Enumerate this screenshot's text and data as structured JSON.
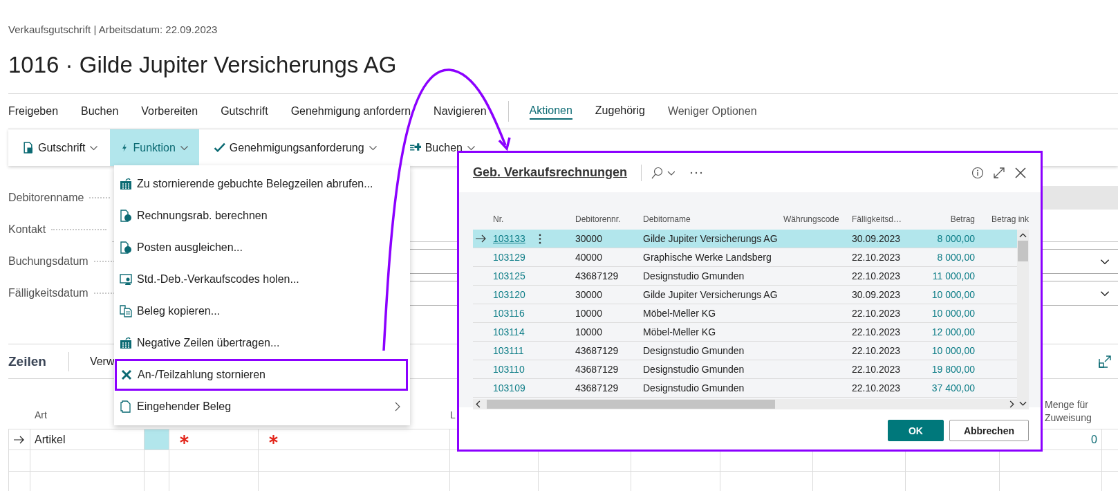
{
  "breadcrumb": "Verkaufsgutschrift | Arbeitsdatum: 22.09.2023",
  "title": "1016 · Gilde Jupiter Versicherungs AG",
  "action_groups": [
    "Freigeben",
    "Buchen",
    "Vorbereiten",
    "Gutschrift",
    "Genehmigung anfordern",
    "Navigieren"
  ],
  "tabs": [
    {
      "label": "Aktionen",
      "selected": true
    },
    {
      "label": "Zugehörig",
      "selected": false
    }
  ],
  "less_options": "Weniger Optionen",
  "toolbar": [
    {
      "label": "Gutschrift",
      "selected": false
    },
    {
      "label": "Funktion",
      "selected": true
    },
    {
      "label": "Genehmigungsanforderung",
      "selected": false
    },
    {
      "label": "Buchen",
      "selected": false
    }
  ],
  "menu": [
    {
      "label": "Zu stornierende gebuchte Belegzeilen abrufen...",
      "kind": "action",
      "annotated": false
    },
    {
      "label": "Rechnungsrab. berechnen",
      "kind": "action",
      "annotated": false
    },
    {
      "label": "Posten ausgleichen...",
      "kind": "action",
      "annotated": false
    },
    {
      "label": "Std.-Deb.-Verkaufscodes holen...",
      "kind": "action",
      "annotated": false
    },
    {
      "label": "Beleg kopieren...",
      "kind": "action",
      "annotated": false
    },
    {
      "label": "Negative Zeilen übertragen...",
      "kind": "action",
      "annotated": false
    },
    {
      "label": "An-/Teilzahlung stornieren",
      "kind": "action",
      "annotated": true
    },
    {
      "label": "Eingehender Beleg",
      "kind": "submenu",
      "annotated": false
    }
  ],
  "fields": [
    {
      "label": "Debitorenname",
      "kind": "readonly"
    },
    {
      "label": "Kontakt",
      "kind": "text"
    },
    {
      "label": "Buchungsdatum",
      "kind": "dropdown"
    },
    {
      "label": "Fälligkeitsdatum",
      "kind": "dropdown"
    }
  ],
  "lines": {
    "title": "Zeilen",
    "action": "Verw",
    "columns": [
      "Art",
      "L",
      "Menge für Zuweisung"
    ],
    "rows": [
      {
        "selected": true,
        "type": "Artikel",
        "required": true,
        "quantity": "0"
      }
    ]
  },
  "dialog": {
    "title": "Geb. Verkaufsrechnungen",
    "columns": [
      "Nr.",
      "Debitorennr.",
      "Debitorname",
      "Währungscode",
      "Fälligkeitsd…",
      "Betrag",
      "Betrag ink"
    ],
    "rows": [
      {
        "selected": true,
        "nr": "103133",
        "customer_no": "30000",
        "name": "Gilde Jupiter Versicherungs AG",
        "due": "30.09.2023",
        "amount": "8 000,00"
      },
      {
        "selected": false,
        "nr": "103129",
        "customer_no": "40000",
        "name": "Graphische Werke Landsberg",
        "due": "22.10.2023",
        "amount": "8 000,00"
      },
      {
        "selected": false,
        "nr": "103125",
        "customer_no": "43687129",
        "name": "Designstudio Gmunden",
        "due": "22.10.2023",
        "amount": "11 000,00"
      },
      {
        "selected": false,
        "nr": "103120",
        "customer_no": "30000",
        "name": "Gilde Jupiter Versicherungs AG",
        "due": "30.09.2023",
        "amount": "10 000,00"
      },
      {
        "selected": false,
        "nr": "103116",
        "customer_no": "10000",
        "name": "Möbel-Meller KG",
        "due": "22.10.2023",
        "amount": "10 000,00"
      },
      {
        "selected": false,
        "nr": "103114",
        "customer_no": "10000",
        "name": "Möbel-Meller KG",
        "due": "22.10.2023",
        "amount": "12 000,00"
      },
      {
        "selected": false,
        "nr": "103111",
        "customer_no": "43687129",
        "name": "Designstudio Gmunden",
        "due": "22.10.2023",
        "amount": "10 000,00"
      },
      {
        "selected": false,
        "nr": "103110",
        "customer_no": "43687129",
        "name": "Designstudio Gmunden",
        "due": "22.10.2023",
        "amount": "19 800,00"
      },
      {
        "selected": false,
        "nr": "103109",
        "customer_no": "43687129",
        "name": "Designstudio Gmunden",
        "due": "22.10.2023",
        "amount": "37 400,00"
      }
    ],
    "buttons": [
      {
        "label": "OK",
        "kind": "primary"
      },
      {
        "label": "Abbrechen",
        "kind": "secondary"
      }
    ]
  }
}
